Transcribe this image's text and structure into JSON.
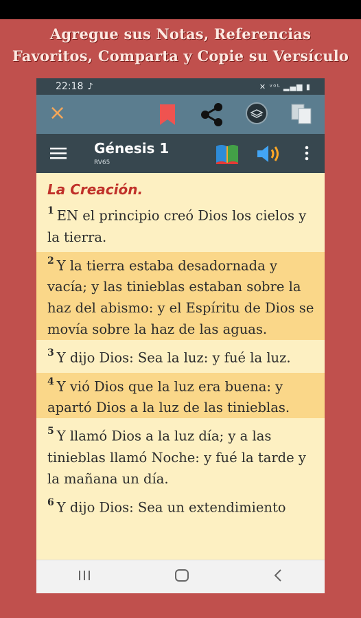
{
  "promo": {
    "line1": "Agregue sus Notas, Referencias",
    "line2": "Favoritos, Comparta y Copie su Versículo"
  },
  "status_bar": {
    "time": "22:18",
    "music_icon": "♪",
    "right_icons": "✕ ᵛᵒᴸ ▂▄▆ ▮"
  },
  "action_bar": {
    "close_label": "×"
  },
  "toolbar": {
    "book_title": "Génesis 1",
    "version": "RV65"
  },
  "content": {
    "section_title": "La Creación.",
    "verses": [
      {
        "num": "1",
        "text": "EN el principio creó Dios los cielos y la tierra.",
        "highlighted": false
      },
      {
        "num": "2",
        "text": "Y la tierra estaba desadornada y vacía; y las tinieblas estaban sobre la haz del abismo: y el Espíritu de Dios se movía sobre la haz de las aguas.",
        "highlighted": true
      },
      {
        "num": "3",
        "text": "Y dijo Dios: Sea la luz: y fué la luz.",
        "highlighted": false
      },
      {
        "num": "4",
        "text": "Y vió Dios que la luz era buena: y apartó Dios a la luz de las tinieblas.",
        "highlighted": true
      },
      {
        "num": "5",
        "text": "Y llamó Dios a la luz día; y a las tinieblas llamó Noche: y fué la tarde y la mañana un día.",
        "highlighted": false
      },
      {
        "num": "6",
        "text": "Y dijo Dios: Sea un extendimiento",
        "highlighted": false
      }
    ]
  },
  "colors": {
    "background": "#c0504d",
    "action_bar": "#5b7d8f",
    "toolbar": "#37474f",
    "page": "#fdf0c2",
    "highlight": "#fad789",
    "section_title": "#c0312a"
  },
  "icons": [
    "close-icon",
    "bookmark-icon",
    "share-icon",
    "layers-icon",
    "copy-icon",
    "menu-icon",
    "book-icon",
    "speaker-icon",
    "more-vert-icon",
    "recent-apps-icon",
    "home-icon",
    "back-icon"
  ]
}
